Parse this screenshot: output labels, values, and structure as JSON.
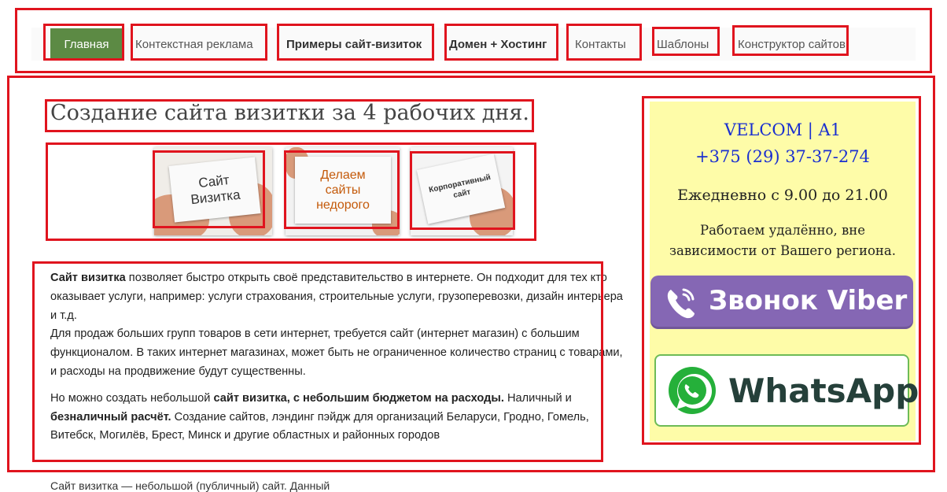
{
  "nav": {
    "items": [
      {
        "label": "Главная"
      },
      {
        "label": "Контекстная реклама"
      },
      {
        "label": "Примеры сайт-визиток"
      },
      {
        "label": "Домен + Хостинг"
      },
      {
        "label": "Контакты"
      },
      {
        "label": "Шаблоны"
      },
      {
        "label": "Конструктор сайтов"
      }
    ]
  },
  "main": {
    "title": "Создание сайта визитки за 4 рабочих дня.",
    "images": [
      {
        "text_line1": "Сайт",
        "text_line2": "Визитка"
      },
      {
        "text_line1": "Делаем",
        "text_line2": "сайты",
        "text_line3": "недорого"
      },
      {
        "text_line1": "Корпоративный",
        "text_line2": "сайт"
      }
    ],
    "p1_bold": "Сайт визитка",
    "p1_text": " позволяет быстро открыть своё представительство в интернете. Он подходит для тех кто оказывает услуги, например: услуги страхования, строительные услуги, грузоперевозки, дизайн интерьера и т.д.",
    "p1b_text": "Для продаж больших групп товаров в сети интернет, требуется сайт  (интернет магазин) с большим функционалом. В таких  интернет магазинах, может быть не ограниченное количество страниц с товарами, и расходы на продвижение будут существенны.",
    "p2_a": "Но можно создать небольшой ",
    "p2_b": "сайт визитка, с небольшим бюджетом на расходы.",
    "p2_c": " Наличный и ",
    "p2_d": "безналичный расчёт.",
    "p2_e": " Создание сайтов, лэндинг пэйдж для организаций Беларуси, Гродно, Гомель, Витебск, Могилёв, Брест, Минск и другие областных и районных городов",
    "bottom_text": "Сайт визитка — небольшой (публичный) сайт. Данный"
  },
  "sidebar": {
    "operator": "VELCOM | A1",
    "phone": "+375 (29) 37-37-274",
    "hours": "Ежедневно с 9.00 до 21.00",
    "remote_line1": "Работаем удалённо, вне",
    "remote_line2": "зависимости от Вашего региона.",
    "viber_label": "Звонок Viber",
    "whatsapp_label": "WhatsApp"
  },
  "colors": {
    "highlight_box": "#e0141e",
    "nav_active": "#5c8a44",
    "sidebar_bg": "#fefca8",
    "phone_link": "#1a2fd0",
    "viber": "#8567b4",
    "whatsapp": "#25b03a"
  }
}
